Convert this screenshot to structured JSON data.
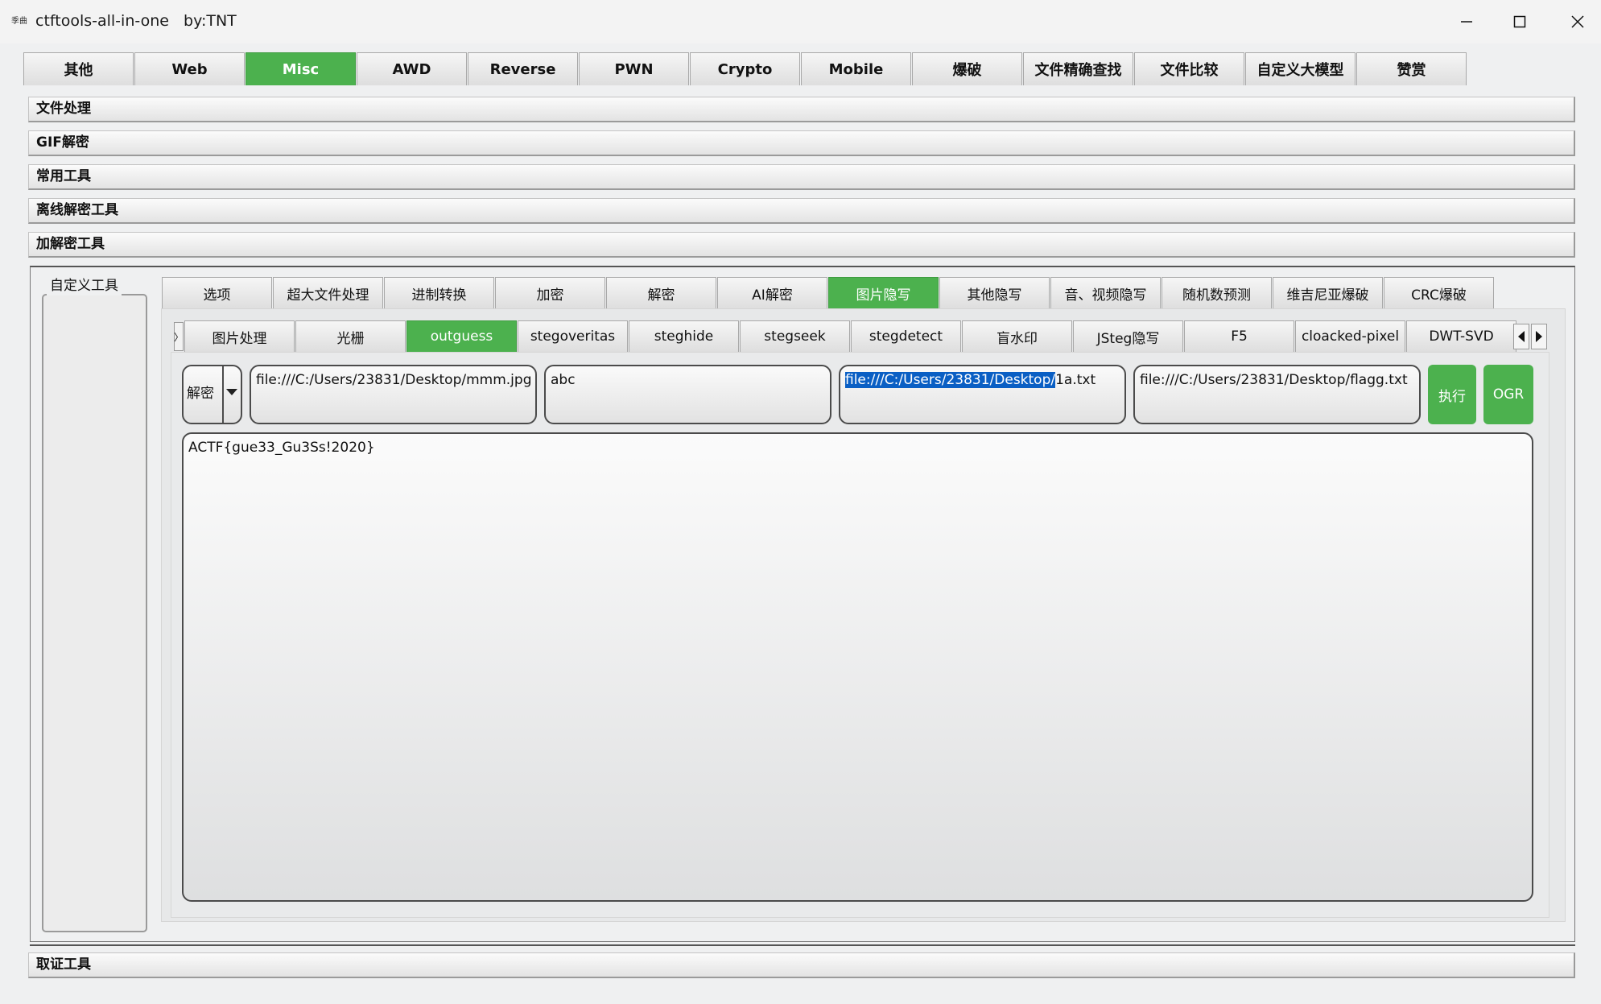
{
  "window": {
    "icon_text": "季曲",
    "title": "ctftools-all-in-one   by:TNT",
    "controls": [
      "minimize",
      "maximize",
      "close"
    ]
  },
  "main_tabs": [
    "其他",
    "Web",
    "Misc",
    "AWD",
    "Reverse",
    "PWN",
    "Crypto",
    "Mobile",
    "爆破",
    "文件精确查找",
    "文件比较",
    "自定义大模型",
    "赞赏"
  ],
  "main_tabs_active": "Misc",
  "sections": [
    "文件处理",
    "GIF解密",
    "常用工具",
    "离线解密工具",
    "加解密工具"
  ],
  "bottom_section": "取证工具",
  "custom_tools": {
    "title": "自定义工具"
  },
  "sub_tabs": [
    "选项",
    "超大文件处理",
    "进制转换",
    "加密",
    "解密",
    "AI解密",
    "图片隐写",
    "其他隐写",
    "音、视频隐写",
    "随机数预测",
    "维吉尼亚爆破",
    "CRC爆破"
  ],
  "sub_tabs_active": "图片隐写",
  "tool_tabs": [
    "图片处理",
    "光栅",
    "outguess",
    "stegoveritas",
    "steghide",
    "stegseek",
    "stegdetect",
    "盲水印",
    "JSteg隐写",
    "F5",
    "cloacked-pixel",
    "DWT-SVD"
  ],
  "tool_tabs_active": "outguess",
  "form": {
    "mode": "解密",
    "image_path": "file:///C:/Users/23831/Desktop/mmm.jpg",
    "key": "abc",
    "message_path_selected": "file:///C:/Users/23831/Desktop/",
    "message_path_rest": "1a.txt",
    "output_path": "file:///C:/Users/23831/Desktop/flagg.txt",
    "execute_button": "执行",
    "ogr_button": "OGR"
  },
  "output_text": "ACTF{gue33_Gu3Ss!2020}",
  "colors": {
    "accent_green": "#4cb14e",
    "selection_blue": "#0a5fc4"
  }
}
